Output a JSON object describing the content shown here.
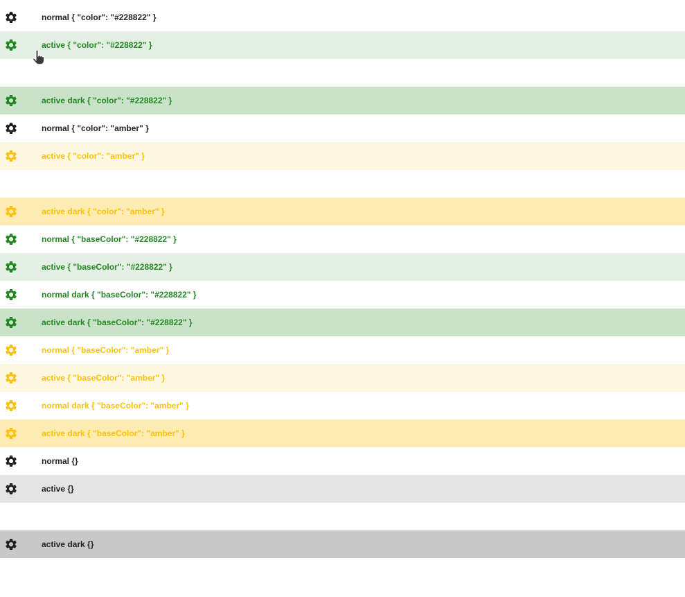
{
  "rows": [
    {
      "label": "normal { \"color\": \"#228822\" }",
      "text_color": "#222222",
      "icon_color": "#222222",
      "bg": "#ffffff",
      "visible": true
    },
    {
      "label": "active { \"color\": \"#228822\" }",
      "text_color": "#228822",
      "icon_color": "#228822",
      "bg": "#e3f0e3",
      "visible": true
    },
    {
      "label": "",
      "text_color": "#228822",
      "icon_color": "#228822",
      "bg": "#ffffff",
      "visible": false
    },
    {
      "label": "active dark { \"color\": \"#228822\" }",
      "text_color": "#228822",
      "icon_color": "#228822",
      "bg": "#c9e2c9",
      "visible": true
    },
    {
      "label": "normal { \"color\": \"amber\" }",
      "text_color": "#222222",
      "icon_color": "#222222",
      "bg": "#ffffff",
      "visible": true
    },
    {
      "label": "active { \"color\": \"amber\" }",
      "text_color": "#ffc107",
      "icon_color": "#ffc107",
      "bg": "#fff8e1",
      "visible": true
    },
    {
      "label": "",
      "text_color": "#ffc107",
      "icon_color": "#ffc107",
      "bg": "#ffffff",
      "visible": false
    },
    {
      "label": "active dark { \"color\": \"amber\" }",
      "text_color": "#ffc107",
      "icon_color": "#ffc107",
      "bg": "#ffecb3",
      "visible": true
    },
    {
      "label": "normal { \"baseColor\": \"#228822\" }",
      "text_color": "#228822",
      "icon_color": "#228822",
      "bg": "#ffffff",
      "visible": true
    },
    {
      "label": "active { \"baseColor\": \"#228822\" }",
      "text_color": "#228822",
      "icon_color": "#228822",
      "bg": "#e3f0e3",
      "visible": true
    },
    {
      "label": "normal dark { \"baseColor\": \"#228822\" }",
      "text_color": "#228822",
      "icon_color": "#228822",
      "bg": "#ffffff",
      "visible": true
    },
    {
      "label": "active dark { \"baseColor\": \"#228822\" }",
      "text_color": "#228822",
      "icon_color": "#228822",
      "bg": "#c9e2c9",
      "visible": true
    },
    {
      "label": "normal { \"baseColor\": \"amber\" }",
      "text_color": "#ffc107",
      "icon_color": "#ffc107",
      "bg": "#ffffff",
      "visible": true
    },
    {
      "label": "active { \"baseColor\": \"amber\" }",
      "text_color": "#ffc107",
      "icon_color": "#ffc107",
      "bg": "#fff8e1",
      "visible": true
    },
    {
      "label": "normal dark { \"baseColor\": \"amber\" }",
      "text_color": "#ffc107",
      "icon_color": "#ffc107",
      "bg": "#ffffff",
      "visible": true
    },
    {
      "label": "active dark { \"baseColor\": \"amber\" }",
      "text_color": "#ffc107",
      "icon_color": "#ffc107",
      "bg": "#ffecb3",
      "visible": true
    },
    {
      "label": "normal {}",
      "text_color": "#222222",
      "icon_color": "#222222",
      "bg": "#ffffff",
      "visible": true
    },
    {
      "label": "active {}",
      "text_color": "#222222",
      "icon_color": "#222222",
      "bg": "#e4e4e4",
      "visible": true
    },
    {
      "label": "",
      "text_color": "#222222",
      "icon_color": "#222222",
      "bg": "#ffffff",
      "visible": false
    },
    {
      "label": "active dark {}",
      "text_color": "#222222",
      "icon_color": "#222222",
      "bg": "#c8c8c8",
      "visible": true
    }
  ],
  "icon_name": "gear-icon",
  "cursor_icon": "hand-pointer-icon"
}
